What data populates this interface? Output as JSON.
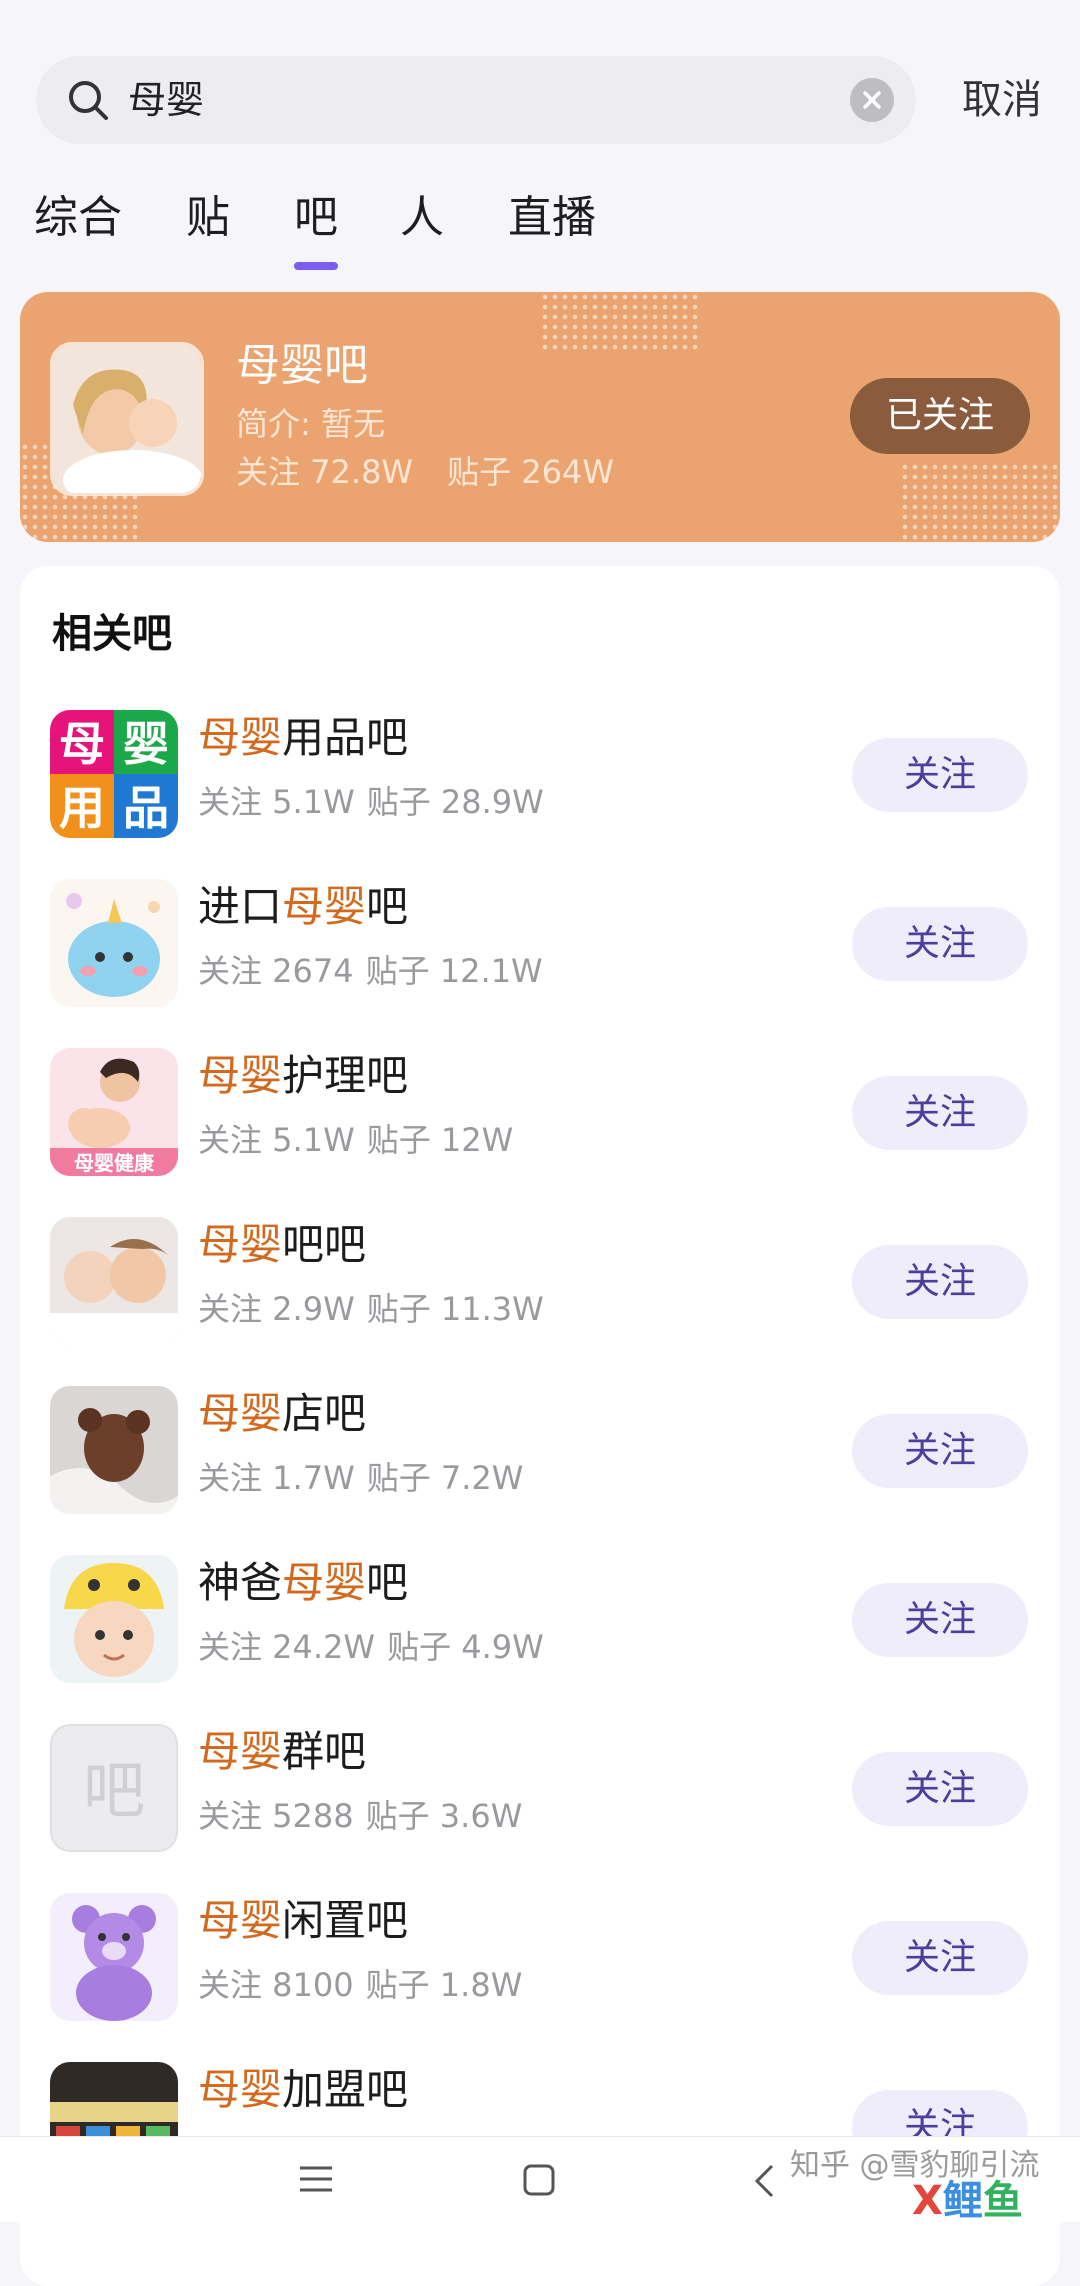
{
  "search": {
    "query": "母婴",
    "cancel_label": "取消"
  },
  "tabs": [
    {
      "label": "综合",
      "active": false
    },
    {
      "label": "贴",
      "active": false
    },
    {
      "label": "吧",
      "active": true
    },
    {
      "label": "人",
      "active": false
    },
    {
      "label": "直播",
      "active": false
    }
  ],
  "hero": {
    "name": "母婴吧",
    "intro": "简介: 暂无",
    "followers": "关注 72.8W",
    "posts": "贴子 264W",
    "button_label": "已关注"
  },
  "related": {
    "title": "相关吧",
    "items": [
      {
        "name_pre": "",
        "name_hl": "母婴",
        "name_post": "用品吧",
        "followers": "关注 5.1W",
        "posts": "贴子 28.9W",
        "button": "关注"
      },
      {
        "name_pre": "进口",
        "name_hl": "母婴",
        "name_post": "吧",
        "followers": "关注 2674",
        "posts": "贴子 12.1W",
        "button": "关注"
      },
      {
        "name_pre": "",
        "name_hl": "母婴",
        "name_post": "护理吧",
        "followers": "关注 5.1W",
        "posts": "贴子 12W",
        "button": "关注"
      },
      {
        "name_pre": "",
        "name_hl": "母婴",
        "name_post": "吧吧",
        "followers": "关注 2.9W",
        "posts": "贴子 11.3W",
        "button": "关注"
      },
      {
        "name_pre": "",
        "name_hl": "母婴",
        "name_post": "店吧",
        "followers": "关注 1.7W",
        "posts": "贴子 7.2W",
        "button": "关注"
      },
      {
        "name_pre": "神爸",
        "name_hl": "母婴",
        "name_post": "吧",
        "followers": "关注 24.2W",
        "posts": "贴子 4.9W",
        "button": "关注"
      },
      {
        "name_pre": "",
        "name_hl": "母婴",
        "name_post": "群吧",
        "followers": "关注 5288",
        "posts": "贴子 3.6W",
        "button": "关注"
      },
      {
        "name_pre": "",
        "name_hl": "母婴",
        "name_post": "闲置吧",
        "followers": "关注 8100",
        "posts": "贴子 1.8W",
        "button": "关注"
      },
      {
        "name_pre": "",
        "name_hl": "母婴",
        "name_post": "加盟吧",
        "followers": "",
        "posts": "",
        "button": "关注"
      }
    ]
  },
  "avatar_text": {
    "logo_chars": [
      "母",
      "婴",
      "用",
      "品"
    ],
    "care_banner": "母婴健康",
    "placeholder": "吧"
  },
  "watermark": "知乎 @雪豹聊引流",
  "brand": "X鲤鱼",
  "colors": {
    "accent": "#7b5cf0",
    "highlight": "#d2691e",
    "hero_bg": "#eba46f"
  }
}
